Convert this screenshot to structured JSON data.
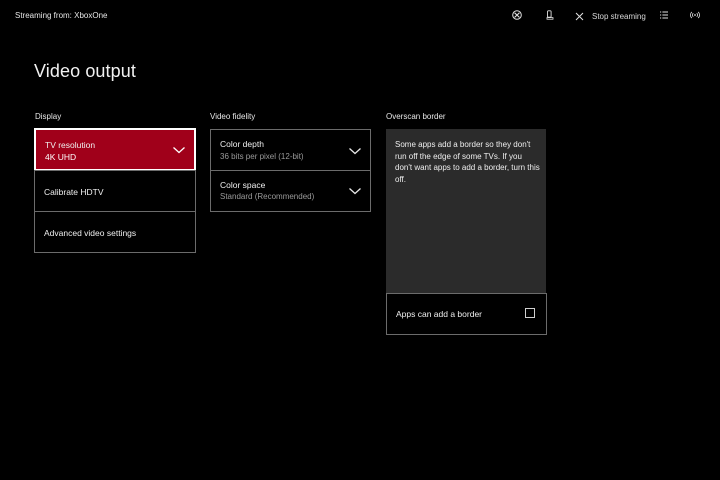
{
  "topbar": {
    "source_label": "Streaming from: XboxOne",
    "stop_label": "Stop streaming",
    "icons": [
      "xbox-icon",
      "remote-icon",
      "close-icon",
      "menu-list-icon",
      "broadcast-icon"
    ]
  },
  "page": {
    "title": "Video output"
  },
  "display": {
    "header": "Display",
    "items": [
      {
        "label": "TV resolution",
        "value": "4K UHD",
        "selected": true,
        "has_dropdown": true
      },
      {
        "label": "Calibrate HDTV"
      },
      {
        "label": "Advanced video settings"
      }
    ]
  },
  "video_fidelity": {
    "header": "Video fidelity",
    "items": [
      {
        "label": "Color depth",
        "value": "36 bits per pixel (12-bit)",
        "has_dropdown": true
      },
      {
        "label": "Color space",
        "value": "Standard (Recommended)",
        "has_dropdown": true
      }
    ]
  },
  "overscan": {
    "header": "Overscan border",
    "description": "Some apps add a border so they don't run off the edge of some TVs. If you don't want apps to add a border, turn this off.",
    "checkbox_label": "Apps can add a border",
    "checked": false
  },
  "colors": {
    "background": "#000000",
    "accent": "#a0001a",
    "tile_border": "#6b6b6b",
    "panel": "#2b2b2b",
    "secondary_text": "#9a9a9a"
  }
}
